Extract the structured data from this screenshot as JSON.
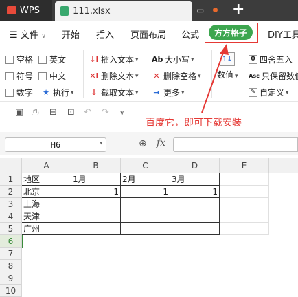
{
  "titlebar": {
    "app_name": "WPS",
    "file_name": "111.xlsx"
  },
  "menu": {
    "file_label": "文件",
    "items": [
      "开始",
      "插入",
      "页面布局",
      "公式"
    ],
    "highlight_tab": "方方格子",
    "last_item": "DIY工具"
  },
  "ribbon": {
    "checkboxes": [
      "空格",
      "英文",
      "符号",
      "中文",
      "数字"
    ],
    "execute_label": "执行",
    "text_buttons": [
      "插入文本",
      "删除文本",
      "截取文本"
    ],
    "case_buttons": [
      "大小写",
      "删除空格",
      "更多"
    ],
    "number_label": "数值",
    "right_buttons": [
      "四舍五入",
      "只保留数值",
      "自定义"
    ]
  },
  "annotation": "百度它，即可下载安装",
  "formula_bar": {
    "cell_ref": "H6",
    "fx": "fx",
    "formula": ""
  },
  "sheet": {
    "columns": [
      "A",
      "B",
      "C",
      "D",
      "E"
    ],
    "rows": [
      "1",
      "2",
      "3",
      "4",
      "5",
      "6",
      "7",
      "8",
      "9",
      "10"
    ],
    "active_row": "6",
    "cells": [
      [
        "地区",
        "1月",
        "2月",
        "3月",
        ""
      ],
      [
        "北京",
        "1",
        "1",
        "1",
        ""
      ],
      [
        "上海",
        "",
        "",
        "",
        ""
      ],
      [
        "天津",
        "",
        "",
        "",
        ""
      ],
      [
        "广州",
        "",
        "",
        "",
        ""
      ]
    ]
  },
  "colors": {
    "accent": "#3da64f",
    "annotation": "#e53935",
    "title_bar": "#3c3c3c"
  }
}
